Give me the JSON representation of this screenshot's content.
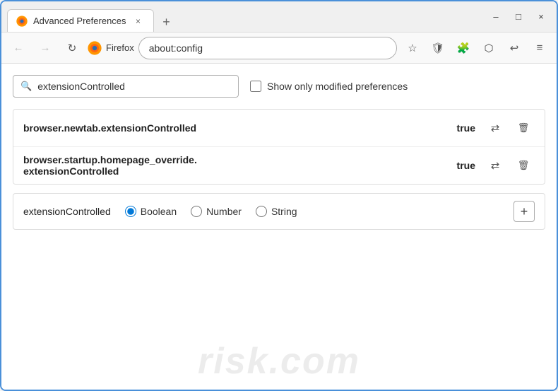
{
  "window": {
    "title": "Advanced Preferences",
    "tab_close": "×",
    "new_tab": "+",
    "minimize": "–",
    "maximize": "□",
    "close": "×"
  },
  "nav": {
    "back": "←",
    "forward": "→",
    "reload": "↻",
    "firefox_label": "Firefox",
    "address": "about:config",
    "bookmark_icon": "☆",
    "shield_icon": "🛡",
    "extension_icon": "🧩",
    "sync_icon": "⬡",
    "history_icon": "↩",
    "menu_icon": "≡"
  },
  "search": {
    "value": "extensionControlled",
    "placeholder": "Search preference name",
    "checkbox_label": "Show only modified preferences"
  },
  "results": [
    {
      "name": "browser.newtab.extensionControlled",
      "value": "true"
    },
    {
      "name_line1": "browser.startup.homepage_override.",
      "name_line2": "extensionControlled",
      "value": "true"
    }
  ],
  "new_pref": {
    "name": "extensionControlled",
    "type_boolean": "Boolean",
    "type_number": "Number",
    "type_string": "String",
    "add_label": "+"
  },
  "watermark": {
    "line1": "risk.com"
  }
}
